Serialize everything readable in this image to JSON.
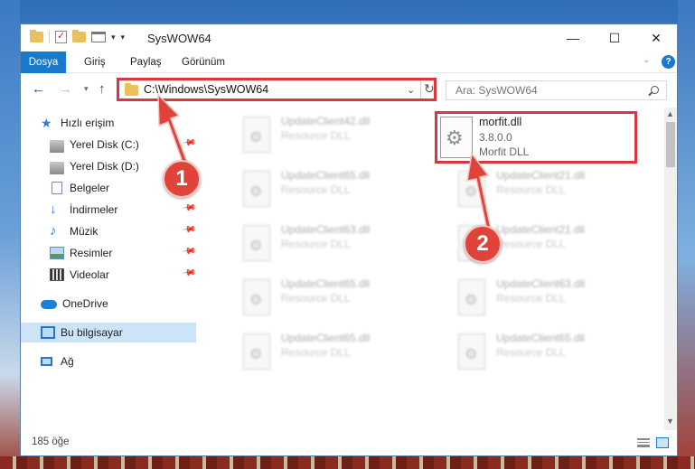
{
  "window": {
    "title": "SysWOW64"
  },
  "ribbon": {
    "tabs": [
      "Dosya",
      "Giriş",
      "Paylaş",
      "Görünüm"
    ],
    "help_label": "?"
  },
  "nav": {
    "address": "C:\\Windows\\SysWOW64",
    "search_placeholder": "Ara: SysWOW64"
  },
  "sidebar": {
    "items": [
      {
        "label": "Hızlı erişim",
        "icon": "star-icon"
      },
      {
        "label": "Yerel Disk (C:)",
        "icon": "disk-icon",
        "pinned": true
      },
      {
        "label": "Yerel Disk (D:)",
        "icon": "disk-icon"
      },
      {
        "label": "Belgeler",
        "icon": "documents-icon"
      },
      {
        "label": "İndirmeler",
        "icon": "downloads-icon",
        "pinned": true
      },
      {
        "label": "Müzik",
        "icon": "music-icon",
        "pinned": true
      },
      {
        "label": "Resimler",
        "icon": "pictures-icon",
        "pinned": true
      },
      {
        "label": "Videolar",
        "icon": "videos-icon",
        "pinned": true
      },
      {
        "label": "OneDrive",
        "icon": "cloud-icon"
      },
      {
        "label": "Bu bilgisayar",
        "icon": "computer-icon",
        "selected": true
      },
      {
        "label": "Ağ",
        "icon": "network-icon"
      }
    ]
  },
  "files": {
    "highlighted": {
      "name": "morfit.dll",
      "version": "3.8.0.0",
      "description": "Morfit DLL"
    },
    "blurred": [
      {
        "name": "UpdateClient42.dll",
        "description": "Resource DLL"
      },
      {
        "name": "UpdateClient65.dll",
        "description": "Resource DLL"
      },
      {
        "name": "UpdateClient21.dll",
        "description": "Resource DLL"
      },
      {
        "name": "UpdateClient63.dll",
        "description": "Resource DLL"
      },
      {
        "name": "UpdateClient21.dll",
        "description": "Resource DLL"
      },
      {
        "name": "UpdateClient65.dll",
        "description": "Resource DLL"
      },
      {
        "name": "UpdateClient63.dll",
        "description": "Resource DLL"
      },
      {
        "name": "UpdateClient65.dll",
        "description": "Resource DLL"
      },
      {
        "name": "UpdateClient65.dll",
        "description": "Resource DLL"
      }
    ]
  },
  "status": {
    "item_count": "185 öğe"
  },
  "annotations": {
    "marker1": "1",
    "marker2": "2",
    "color": "#e0433a"
  },
  "colors": {
    "accent": "#1979ca",
    "highlight_border": "#d8373f",
    "selection": "#cce4f7"
  }
}
